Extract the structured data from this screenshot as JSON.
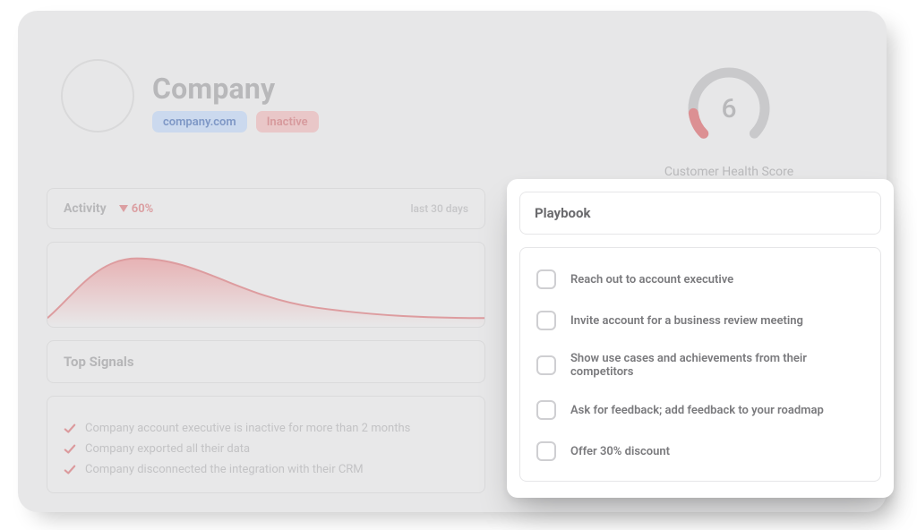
{
  "company": {
    "name": "Company",
    "domain": "company.com",
    "status": "Inactive"
  },
  "health": {
    "score": "6",
    "label": "Customer Health Score"
  },
  "activity": {
    "title": "Activity",
    "delta": "60%",
    "range": "last 30 days"
  },
  "signals": {
    "title": "Top Signals",
    "items": [
      "Company account executive is inactive for more than 2 months",
      "Company exported all their data",
      "Company disconnected the integration with their CRM"
    ]
  },
  "playbook": {
    "title": "Playbook",
    "items": [
      "Reach out to account executive",
      "Invite account for a business review meeting",
      "Show use cases and achievements from their competitors",
      "Ask for feedback; add feedback to your roadmap",
      "Offer 30% discount"
    ]
  }
}
